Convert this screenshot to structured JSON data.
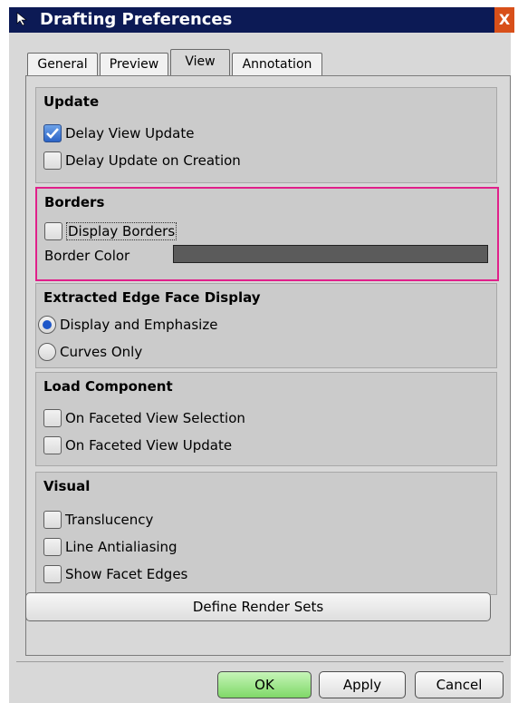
{
  "window": {
    "title": "Drafting Preferences",
    "close_label": "X"
  },
  "tabs": [
    {
      "label": "General"
    },
    {
      "label": "Preview"
    },
    {
      "label": "View"
    },
    {
      "label": "Annotation"
    }
  ],
  "groups": {
    "update": {
      "title": "Update",
      "delay_view_update": {
        "label": "Delay View Update",
        "checked": true
      },
      "delay_update_on_creation": {
        "label": "Delay Update on Creation",
        "checked": false
      }
    },
    "borders": {
      "title": "Borders",
      "display_borders": {
        "label": "Display Borders",
        "checked": false
      },
      "border_color_label": "Border Color",
      "border_color": "#5b5b5b"
    },
    "extracted_edge": {
      "title": "Extracted Edge Face Display",
      "options": [
        {
          "label": "Display and Emphasize",
          "selected": true
        },
        {
          "label": "Curves Only",
          "selected": false
        }
      ]
    },
    "load_component": {
      "title": "Load Component",
      "on_faceted_view_selection": {
        "label": "On Faceted View Selection",
        "checked": false
      },
      "on_faceted_view_update": {
        "label": "On Faceted View Update",
        "checked": false
      }
    },
    "visual": {
      "title": "Visual",
      "translucency": {
        "label": "Translucency",
        "checked": false
      },
      "line_antialiasing": {
        "label": "Line Antialiasing",
        "checked": false
      },
      "show_facet_edges": {
        "label": "Show Facet Edges",
        "checked": false
      }
    }
  },
  "define_render_sets_label": "Define Render Sets",
  "footer": {
    "ok_label": "OK",
    "apply_label": "Apply",
    "cancel_label": "Cancel"
  },
  "colors": {
    "title_bar": "#0c1a55",
    "highlight": "#e0208a",
    "ok_button": "#8fdc7a"
  }
}
